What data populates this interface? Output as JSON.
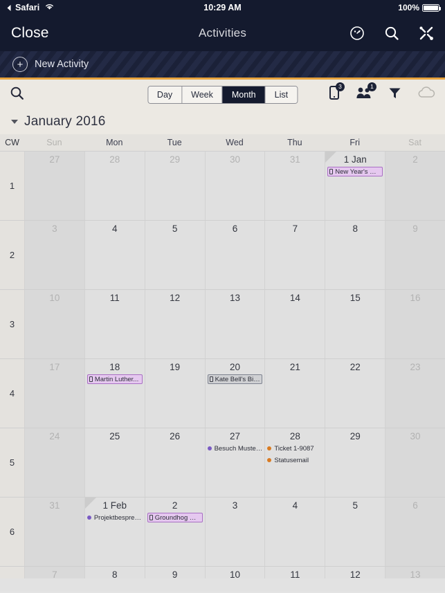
{
  "status_bar": {
    "back_app": "Safari",
    "wifi_icon": "wifi-icon",
    "time": "10:29 AM",
    "battery_percent": "100%"
  },
  "navbar": {
    "close_label": "Close",
    "title": "Activities",
    "icons": [
      "clock-icon",
      "search-icon",
      "tools-icon"
    ]
  },
  "new_activity_bar": {
    "plus": "+",
    "label": "New Activity"
  },
  "toolbar": {
    "search_icon": "search-icon",
    "views": [
      {
        "label": "Day",
        "active": false
      },
      {
        "label": "Week",
        "active": false
      },
      {
        "label": "Month",
        "active": true
      },
      {
        "label": "List",
        "active": false
      }
    ],
    "right_icons": [
      {
        "name": "mobile-device-icon",
        "badge": "3"
      },
      {
        "name": "people-group-icon",
        "badge": "1"
      },
      {
        "name": "filter-icon",
        "badge": ""
      },
      {
        "name": "cloud-icon",
        "badge": ""
      }
    ]
  },
  "month_header": {
    "caret": "chevron-down-icon",
    "title": "January 2016"
  },
  "calendar": {
    "cw_header": "CW",
    "day_names": [
      "Sun",
      "Mon",
      "Tue",
      "Wed",
      "Thu",
      "Fri",
      "Sat"
    ],
    "colors": {
      "purple_event_border": "#a96fc4",
      "purple_event_bg": "#e5c8ef",
      "gray_event_border": "#7d828f",
      "gray_event_bg": "#cfd0d3",
      "purple_dot": "#7a5bc4",
      "orange_dot": "#d97b22",
      "accent_orange": "#e8a33d",
      "navy": "#141a2e"
    },
    "weeks": [
      {
        "cw": "1",
        "days": [
          {
            "num": "27",
            "other_month": true,
            "weekend": true,
            "events": []
          },
          {
            "num": "28",
            "other_month": true,
            "weekend": false,
            "events": []
          },
          {
            "num": "29",
            "other_month": true,
            "weekend": false,
            "events": []
          },
          {
            "num": "30",
            "other_month": true,
            "weekend": false,
            "events": []
          },
          {
            "num": "31",
            "other_month": true,
            "weekend": false,
            "events": []
          },
          {
            "num": "1 Jan",
            "other_month": false,
            "weekend": false,
            "today": true,
            "events": [
              {
                "title": "New Year's Day",
                "style": "boxed-purple",
                "icon": "phone-icon"
              }
            ]
          },
          {
            "num": "2",
            "other_month": true,
            "weekend": true,
            "events": []
          }
        ]
      },
      {
        "cw": "2",
        "days": [
          {
            "num": "3",
            "other_month": true,
            "weekend": true,
            "events": []
          },
          {
            "num": "4",
            "other_month": false,
            "weekend": false,
            "events": []
          },
          {
            "num": "5",
            "other_month": false,
            "weekend": false,
            "events": []
          },
          {
            "num": "6",
            "other_month": false,
            "weekend": false,
            "events": []
          },
          {
            "num": "7",
            "other_month": false,
            "weekend": false,
            "events": []
          },
          {
            "num": "8",
            "other_month": false,
            "weekend": false,
            "events": []
          },
          {
            "num": "9",
            "other_month": true,
            "weekend": true,
            "events": []
          }
        ]
      },
      {
        "cw": "3",
        "days": [
          {
            "num": "10",
            "other_month": true,
            "weekend": true,
            "events": []
          },
          {
            "num": "11",
            "other_month": false,
            "weekend": false,
            "events": []
          },
          {
            "num": "12",
            "other_month": false,
            "weekend": false,
            "events": []
          },
          {
            "num": "13",
            "other_month": false,
            "weekend": false,
            "events": []
          },
          {
            "num": "14",
            "other_month": false,
            "weekend": false,
            "events": []
          },
          {
            "num": "15",
            "other_month": false,
            "weekend": false,
            "events": []
          },
          {
            "num": "16",
            "other_month": true,
            "weekend": true,
            "events": []
          }
        ]
      },
      {
        "cw": "4",
        "days": [
          {
            "num": "17",
            "other_month": true,
            "weekend": true,
            "events": []
          },
          {
            "num": "18",
            "other_month": false,
            "weekend": false,
            "events": [
              {
                "title": "Martin Luther...",
                "style": "boxed-purple",
                "icon": "phone-icon"
              }
            ]
          },
          {
            "num": "19",
            "other_month": false,
            "weekend": false,
            "events": []
          },
          {
            "num": "20",
            "other_month": false,
            "weekend": false,
            "events": [
              {
                "title": "Kate Bell's Birt...",
                "style": "boxed-gray",
                "icon": "phone-icon"
              }
            ]
          },
          {
            "num": "21",
            "other_month": false,
            "weekend": false,
            "events": []
          },
          {
            "num": "22",
            "other_month": false,
            "weekend": false,
            "events": []
          },
          {
            "num": "23",
            "other_month": true,
            "weekend": true,
            "events": []
          }
        ]
      },
      {
        "cw": "5",
        "days": [
          {
            "num": "24",
            "other_month": true,
            "weekend": true,
            "events": []
          },
          {
            "num": "25",
            "other_month": false,
            "weekend": false,
            "events": []
          },
          {
            "num": "26",
            "other_month": false,
            "weekend": false,
            "events": []
          },
          {
            "num": "27",
            "other_month": false,
            "weekend": false,
            "events": [
              {
                "title": "Besuch Muster...",
                "style": "dot-purple",
                "icon": "dot-icon"
              }
            ]
          },
          {
            "num": "28",
            "other_month": false,
            "weekend": false,
            "events": [
              {
                "title": "Ticket 1-9087",
                "style": "dot-orange",
                "icon": "dot-icon"
              },
              {
                "title": "Statusemail",
                "style": "dot-orange",
                "icon": "dot-icon"
              }
            ]
          },
          {
            "num": "29",
            "other_month": false,
            "weekend": false,
            "events": []
          },
          {
            "num": "30",
            "other_month": true,
            "weekend": true,
            "events": []
          }
        ]
      },
      {
        "cw": "6",
        "days": [
          {
            "num": "31",
            "other_month": true,
            "weekend": true,
            "events": []
          },
          {
            "num": "1 Feb",
            "other_month": false,
            "weekend": false,
            "today": true,
            "events": [
              {
                "title": "Projektbesprec...",
                "style": "dot-purple",
                "icon": "dot-icon"
              }
            ]
          },
          {
            "num": "2",
            "other_month": false,
            "weekend": false,
            "events": [
              {
                "title": "Groundhog Day",
                "style": "boxed-purple",
                "icon": "phone-icon"
              }
            ]
          },
          {
            "num": "3",
            "other_month": false,
            "weekend": false,
            "events": []
          },
          {
            "num": "4",
            "other_month": false,
            "weekend": false,
            "events": []
          },
          {
            "num": "5",
            "other_month": false,
            "weekend": false,
            "events": []
          },
          {
            "num": "6",
            "other_month": true,
            "weekend": true,
            "events": []
          }
        ]
      },
      {
        "cw": "",
        "partial": true,
        "days": [
          {
            "num": "7",
            "other_month": true,
            "weekend": true,
            "events": []
          },
          {
            "num": "8",
            "other_month": false,
            "weekend": false,
            "events": []
          },
          {
            "num": "9",
            "other_month": false,
            "weekend": false,
            "events": []
          },
          {
            "num": "10",
            "other_month": false,
            "weekend": false,
            "events": []
          },
          {
            "num": "11",
            "other_month": false,
            "weekend": false,
            "events": []
          },
          {
            "num": "12",
            "other_month": false,
            "weekend": false,
            "events": []
          },
          {
            "num": "13",
            "other_month": true,
            "weekend": true,
            "events": []
          }
        ]
      }
    ]
  }
}
